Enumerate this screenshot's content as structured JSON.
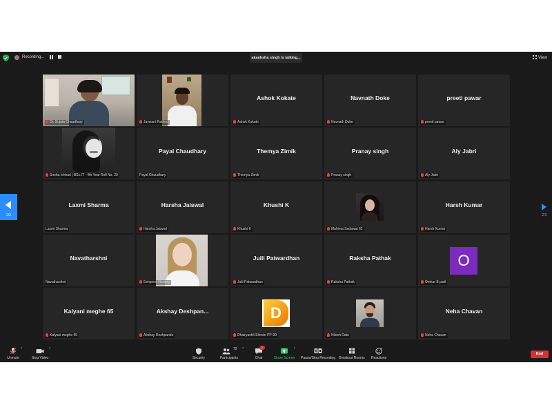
{
  "top_bar": {
    "recording_label": "Recording...",
    "talking_label": "akanksha singh is talking...",
    "view_label": "View"
  },
  "pagination": {
    "left_page": "2/3",
    "right_page": "2/3"
  },
  "tiles": [
    {
      "display_name": "",
      "label": "Dr. Sujata Chaudhary",
      "muted": true
    },
    {
      "display_name": "",
      "label": "Jaywant Rathod",
      "muted": true
    },
    {
      "display_name": "Ashok Kokate",
      "label": "Ashok Kokate",
      "muted": true
    },
    {
      "display_name": "Navnath Doke",
      "label": "Navnath Doke",
      "muted": true
    },
    {
      "display_name": "preeti pawar",
      "label": "preeti pawar",
      "muted": true
    },
    {
      "display_name": "",
      "label": "Sneha Ichhari | BSc.IT - 4th Year Roll No. 20",
      "muted": true
    },
    {
      "display_name": "Payal Chaudhary",
      "label": "Payal Chaudhary",
      "muted": false
    },
    {
      "display_name": "Themya Zimik",
      "label": "Themya Zimik",
      "muted": true
    },
    {
      "display_name": "Pranay singh",
      "label": "Pranay singh",
      "muted": true
    },
    {
      "display_name": "Aly Jabri",
      "label": "Aly Jabri",
      "muted": true
    },
    {
      "display_name": "Laxmi Sharma",
      "label": "Laxmi Sharma",
      "muted": false
    },
    {
      "display_name": "Harsha Jaiswal",
      "label": "Harsha Jaiswal",
      "muted": true
    },
    {
      "display_name": "Khushi K",
      "label": "Khushi K",
      "muted": true
    },
    {
      "display_name": "",
      "label": "Mahima Sadawat 62",
      "muted": true
    },
    {
      "display_name": "Harsh Kumar",
      "label": "Harsh Kumar",
      "muted": true
    },
    {
      "display_name": "Navatharshni",
      "label": "Navatharshni",
      "muted": false
    },
    {
      "display_name": "",
      "label": "Eshpreet Narang",
      "muted": true
    },
    {
      "display_name": "Juili Patwardhan",
      "label": "Juili Patwardhan",
      "muted": true
    },
    {
      "display_name": "Raksha Pathak",
      "label": "Raksha Pathak",
      "muted": true
    },
    {
      "display_name": "",
      "avatar_letter": "O",
      "label": "Omkar B patil",
      "muted": true
    },
    {
      "display_name": "Kalyani meghe 65",
      "label": "Kalyani meghe 65",
      "muted": true
    },
    {
      "display_name": "Akshay  Deshpan...",
      "label": "Akshay Deshpande",
      "muted": true
    },
    {
      "display_name": "",
      "avatar_letter": "D",
      "label": "Dhairyashil Shinde PP-99",
      "muted": true
    },
    {
      "display_name": "",
      "label": "Nilesh Date",
      "muted": true
    },
    {
      "display_name": "Neha Chavan",
      "label": "Neha Chavan",
      "muted": true
    }
  ],
  "toolbar": {
    "unmute_label": "Unmute",
    "stop_video_label": "Stop Video",
    "security_label": "Security",
    "participants_label": "Participants",
    "participants_count": "72",
    "chat_label": "Chat",
    "chat_badge": "2",
    "share_screen_label": "Share Screen",
    "recording_label": "Pause/Stop Recording",
    "breakout_label": "Breakout Rooms",
    "reactions_label": "Reactions",
    "end_label": "End"
  },
  "colors": {
    "meeting_bg": "#1a1a1a",
    "tile_bg": "#262626",
    "accent_blue": "#2d8cff",
    "end_red": "#d93131",
    "share_green": "#3ac26a",
    "avatar_purple": "#7b2cbf",
    "muted_red": "#e04444"
  }
}
